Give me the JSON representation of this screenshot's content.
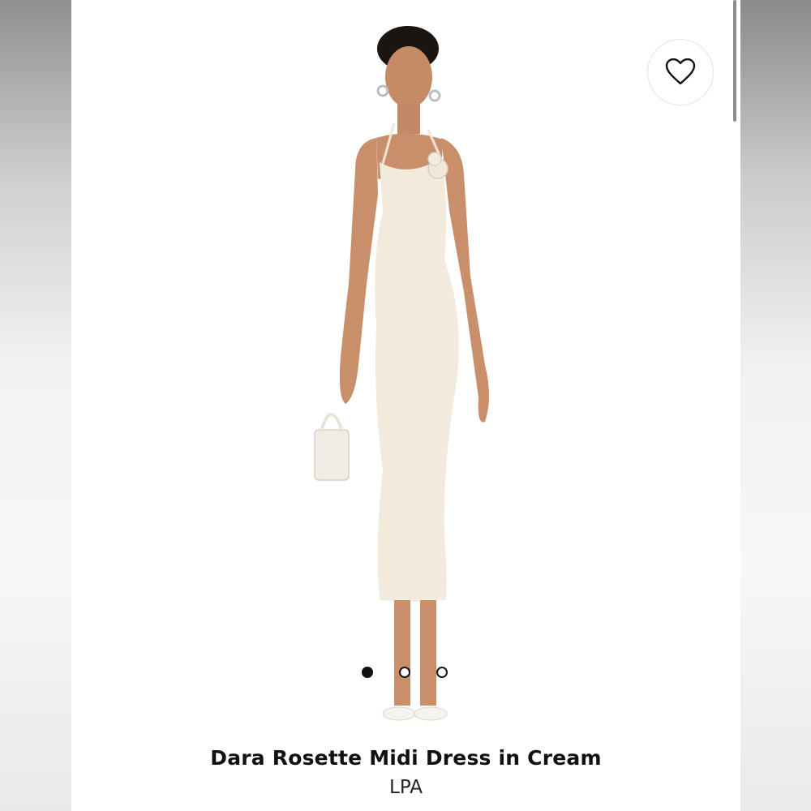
{
  "product": {
    "name": "Dara Rosette Midi Dress in Cream",
    "brand": "LPA",
    "image_icon": "product-photo"
  },
  "carousel": {
    "total": 3,
    "active_index": 0
  },
  "wishlist": {
    "icon": "heart-icon"
  },
  "colors": {
    "dress": "#f2ebdd",
    "skin": "#c98f6b",
    "background": "#ffffff"
  }
}
